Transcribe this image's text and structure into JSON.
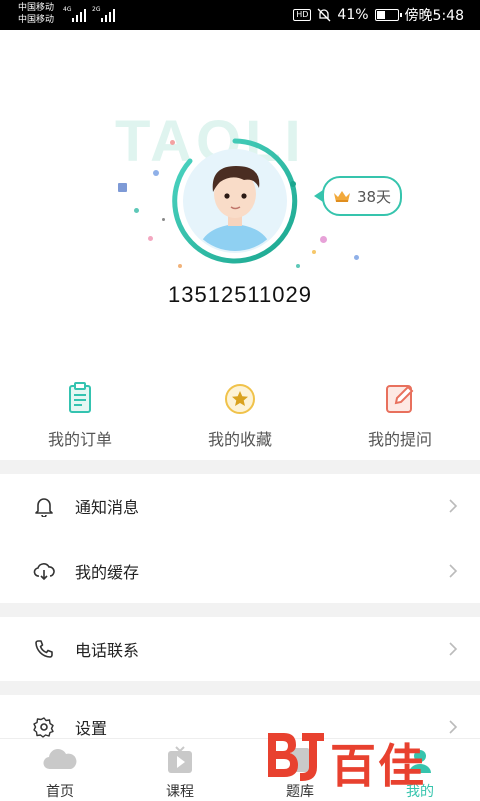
{
  "status_bar": {
    "carrier_1": "中国移动",
    "carrier_2": "中国移动",
    "net_1": "4G",
    "net_2": "2G",
    "hd": "HD",
    "battery": "41%",
    "time": "傍晚5:48"
  },
  "profile": {
    "watermark": "TAOLI",
    "days_badge": "38天",
    "phone": "13512511029"
  },
  "shortcuts": [
    {
      "label": "我的订单",
      "icon": "order-icon",
      "color": "#34c3b0"
    },
    {
      "label": "我的收藏",
      "icon": "star-icon",
      "color": "#f0c24a"
    },
    {
      "label": "我的提问",
      "icon": "edit-icon",
      "color": "#e8705d"
    }
  ],
  "menu": [
    {
      "label": "通知消息",
      "icon": "bell-icon"
    },
    {
      "label": "我的缓存",
      "icon": "cloud-download-icon"
    },
    {
      "label": "电话联系",
      "icon": "phone-icon"
    },
    {
      "label": "设置",
      "icon": "gear-icon"
    }
  ],
  "tabs": [
    {
      "label": "首页",
      "icon": "home-icon"
    },
    {
      "label": "课程",
      "icon": "video-icon"
    },
    {
      "label": "题库",
      "icon": "question-bank-icon"
    },
    {
      "label": "我的",
      "icon": "user-icon",
      "active": true
    }
  ],
  "watermark_logo": "百佳",
  "colors": {
    "accent": "#36c4ad",
    "logo": "#e8412f",
    "divider": "#f2f2f2"
  }
}
